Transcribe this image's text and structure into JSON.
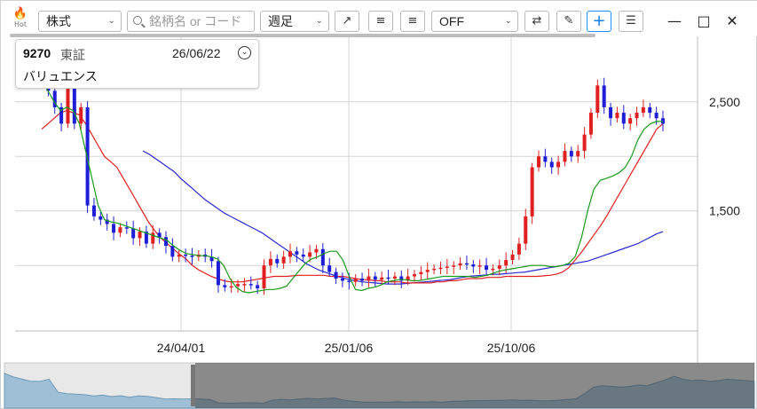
{
  "toolbar": {
    "hot_label": "Hot",
    "market_select": "株式",
    "search_placeholder": "銘柄名 or コード",
    "period_select": "週足",
    "indicator_select": "OFF"
  },
  "icons": {
    "hot": "flame-icon",
    "search": "search-icon",
    "diagonal_arrow": "arrow-up-right-icon",
    "align_left": "align-left-icon",
    "align_right": "align-right-icon",
    "shuffle": "shuffle-icon",
    "pen": "pencil-icon",
    "crosshair": "crosshair-icon",
    "settings": "sliders-icon",
    "minimize": "minimize-icon",
    "maximize": "maximize-icon",
    "close": "close-icon"
  },
  "stock": {
    "code": "9270",
    "market": "東証",
    "date": "26/06/22",
    "name": "バリュエンス"
  },
  "colors": {
    "up": "#e02020",
    "down": "#1e1ed8",
    "ma_short": "#1a9a1a",
    "ma_mid": "#e02020",
    "ma_long": "#2a2ad0",
    "grid": "#d6d6d6",
    "navigator_fill": "#9fbfd6",
    "accent": "#1e90ff"
  },
  "chart_data": {
    "type": "candlestick",
    "y_ticks": [
      "2,500",
      "1,500"
    ],
    "y_tick_values": [
      2500,
      1500
    ],
    "x_ticks": [
      "24/04/01",
      "25/01/06",
      "25/10/06"
    ],
    "ylim": [
      400,
      3100
    ],
    "grid": true,
    "series": [
      {
        "name": "",
        "kind": "ma_short",
        "values": [
          2700,
          2600,
          2500,
          2420,
          2450,
          2420,
          2300,
          2050,
          1800,
          1550,
          1420,
          1400,
          1390,
          1370,
          1350,
          1330,
          1310,
          1290,
          1270,
          1250,
          1230,
          1180,
          1140,
          1110,
          1100,
          1090,
          1090,
          1080,
          1060,
          1000,
          880,
          800,
          760,
          750,
          760,
          770,
          780,
          780,
          790,
          810,
          880,
          950,
          1020,
          1060,
          1080,
          1110,
          1130,
          1130,
          1050,
          900,
          780,
          770,
          790,
          800,
          820,
          850,
          860,
          870,
          870,
          860,
          860,
          870,
          880,
          890,
          900,
          900,
          900,
          900,
          900,
          890,
          900,
          910,
          930,
          950,
          960,
          970,
          980,
          990,
          1000,
          1000,
          1000,
          990,
          990,
          1000,
          1020,
          1080,
          1250,
          1500,
          1700,
          1780,
          1800,
          1820,
          1850,
          1900,
          2000,
          2150,
          2250,
          2300,
          2320,
          2320
        ]
      },
      {
        "name": "",
        "kind": "ma_mid",
        "values": [
          2250,
          2300,
          2350,
          2400,
          2420,
          2400,
          2380,
          2300,
          2200,
          2100,
          2000,
          1950,
          1900,
          1800,
          1700,
          1600,
          1500,
          1400,
          1320,
          1250,
          1200,
          1150,
          1100,
          1060,
          1000,
          960,
          930,
          900,
          880,
          860,
          850,
          850,
          850,
          860,
          870,
          880,
          890,
          900,
          900,
          900,
          905,
          910,
          910,
          910,
          910,
          910,
          900,
          900,
          900,
          890,
          880,
          870,
          870,
          860,
          860,
          850,
          850,
          850,
          840,
          840,
          840,
          840,
          840,
          850,
          850,
          860,
          860,
          870,
          880,
          880,
          880,
          890,
          890,
          890,
          900,
          900,
          900,
          900,
          900,
          900,
          905,
          910,
          920,
          940,
          980,
          1050,
          1120,
          1200,
          1280,
          1360,
          1450,
          1550,
          1650,
          1750,
          1850,
          1950,
          2050,
          2150,
          2250,
          2300
        ]
      },
      {
        "name": "",
        "kind": "ma_long",
        "values": [
          2050,
          2020,
          1980,
          1940,
          1900,
          1860,
          1800,
          1750,
          1700,
          1650,
          1600,
          1560,
          1520,
          1480,
          1450,
          1420,
          1390,
          1360,
          1330,
          1300,
          1260,
          1220,
          1180,
          1140,
          1100,
          1060,
          1020,
          990,
          960,
          940,
          920,
          900,
          885,
          870,
          860,
          850,
          845,
          840,
          835,
          830,
          830,
          830,
          835,
          840,
          845,
          850,
          855,
          860,
          865,
          870,
          880,
          890,
          900,
          905,
          910,
          915,
          920,
          920,
          925,
          930,
          935,
          940,
          950,
          960,
          970,
          980,
          990,
          1000,
          1010,
          1020,
          1030,
          1040,
          1060,
          1080,
          1100,
          1120,
          1140,
          1160,
          1180,
          1200,
          1230,
          1260,
          1290,
          1310
        ]
      },
      {
        "name": "",
        "kind": "price",
        "values": [
          2850,
          2600,
          2450,
          2300,
          2650,
          2300,
          2450,
          1550,
          1450,
          1420,
          1380,
          1300,
          1350,
          1340,
          1250,
          1310,
          1200,
          1300,
          1260,
          1180,
          1080,
          1100,
          1090,
          1080,
          1100,
          1080,
          1040,
          820,
          800,
          810,
          830,
          830,
          820,
          790,
          1000,
          1060,
          1020,
          1080,
          1130,
          1100,
          1080,
          1120,
          1150,
          1000,
          940,
          880,
          860,
          850,
          880,
          860,
          900,
          870,
          890,
          880,
          900,
          860,
          900,
          920,
          940,
          960,
          970,
          980,
          990,
          1000,
          1020,
          1010,
          990,
          1000,
          960,
          970,
          1000,
          1050,
          1100,
          1200,
          1450,
          1900,
          2000,
          1950,
          1900,
          1950,
          2050,
          2000,
          2050,
          2200,
          2400,
          2650,
          2450,
          2350,
          2400,
          2300,
          2350,
          2400,
          2450,
          2400,
          2350,
          2300
        ]
      }
    ]
  }
}
